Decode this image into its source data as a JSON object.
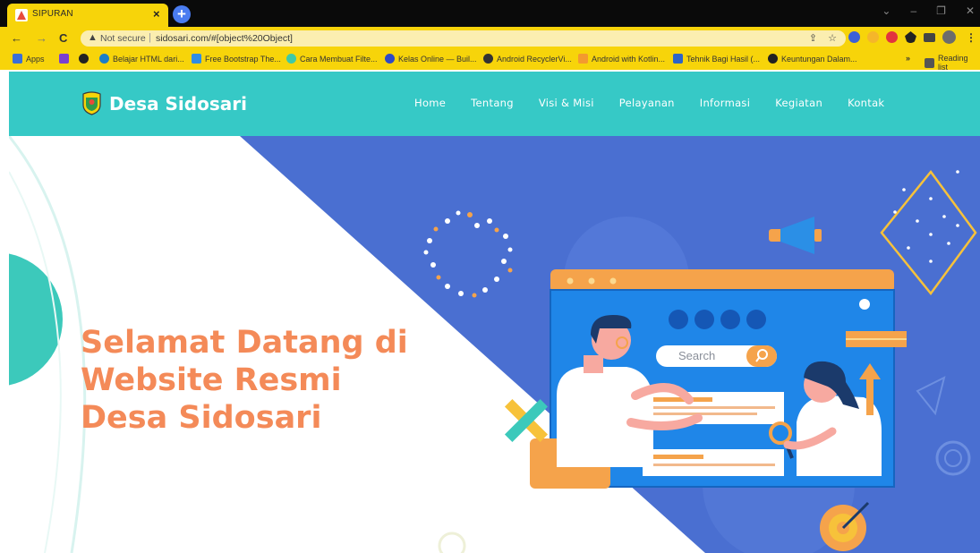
{
  "browser": {
    "tab_title": "SIPURAN",
    "tab_close": "×",
    "new_tab": "+",
    "window_controls": [
      "⌄",
      "–",
      "❐",
      "✕"
    ],
    "nav": {
      "back": "←",
      "forward": "→",
      "reload": "C"
    },
    "omnibox": {
      "warning": "▲",
      "security_text": "Not secure",
      "separator": "|",
      "url": "sidosari.com/#[object%20Object]",
      "share": "⇪",
      "star": "☆"
    },
    "menu": "⋮",
    "bookmarks": [
      {
        "label": "Apps",
        "icon": "apps-grid-icon",
        "color": "#3b6fd8"
      },
      {
        "label": "",
        "icon": "purple-extension-icon",
        "color": "#7a3fd1"
      },
      {
        "label": "",
        "icon": "github-icon",
        "color": "#222222"
      },
      {
        "label": "Belajar HTML dari...",
        "icon": "site-icon",
        "color": "#1a7ec9"
      },
      {
        "label": "Free Bootstrap The...",
        "icon": "bootstrap-icon",
        "color": "#2f8de4"
      },
      {
        "label": "Cara Membuat Filte...",
        "icon": "site-icon",
        "color": "#3ec9a7"
      },
      {
        "label": "Kelas Online — Buil...",
        "icon": "dicoding-icon",
        "color": "#2e49c7"
      },
      {
        "label": "Android RecyclerVi...",
        "icon": "android-icon",
        "color": "#333333"
      },
      {
        "label": "Android with Kotlin...",
        "icon": "kotlin-icon",
        "color": "#f39a2f"
      },
      {
        "label": "Tehnik Bagi Hasil (...",
        "icon": "facebook-icon",
        "color": "#2d64c8"
      },
      {
        "label": "Keuntungan Dalam...",
        "icon": "github-icon",
        "color": "#222222"
      }
    ],
    "bookmarks_more": "»",
    "reading_list": "Reading list"
  },
  "site": {
    "brand": "Desa Sidosari",
    "menu": [
      "Home",
      "Tentang",
      "Visi & Misi",
      "Pelayanan",
      "Informasi",
      "Kegiatan",
      "Kontak"
    ],
    "hero_title": [
      "Selamat Datang di",
      "Website Resmi",
      "Desa Sidosari"
    ],
    "search_placeholder": "Search"
  },
  "colors": {
    "chrome_accent": "#f7d40a",
    "navbar": "#36c9c6",
    "hero_blue": "#4a6fd1",
    "hero_text": "#f48a58",
    "screen_blue": "#1f86e8",
    "accent_orange": "#f5a34b"
  }
}
